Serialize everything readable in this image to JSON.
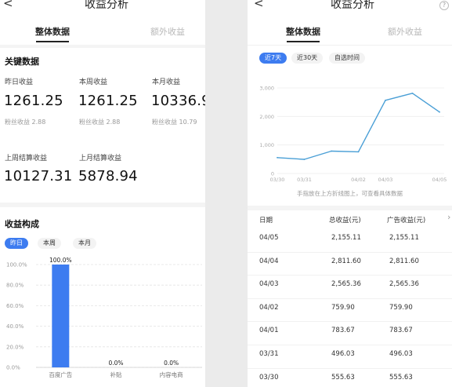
{
  "left": {
    "title": "收益分析",
    "back_glyph": "<",
    "tabs": [
      {
        "label": "整体数据",
        "active": true
      },
      {
        "label": "额外收益",
        "active": false
      }
    ],
    "key_title": "关键数据",
    "metrics": [
      {
        "label": "昨日收益",
        "value": "1261.25",
        "sub": "粉丝收益 2.88"
      },
      {
        "label": "本周收益",
        "value": "1261.25",
        "sub": "粉丝收益 2.88"
      },
      {
        "label": "本月收益",
        "value": "10336.9",
        "sub": "粉丝收益 10.79"
      },
      {
        "label": "上周结算收益",
        "value": "10127.31",
        "sub": ""
      },
      {
        "label": "上月结算收益",
        "value": "5878.94",
        "sub": ""
      }
    ],
    "composition_title": "收益构成",
    "period_pills": [
      {
        "label": "昨日",
        "selected": true
      },
      {
        "label": "本周",
        "selected": false
      },
      {
        "label": "本月",
        "selected": false
      }
    ]
  },
  "right": {
    "title": "收益分析",
    "back_glyph": "<",
    "help_glyph": "?",
    "tabs": [
      {
        "label": "整体数据",
        "active": true
      },
      {
        "label": "额外收益",
        "active": false
      }
    ],
    "range_pills": [
      {
        "label": "近7天",
        "selected": true
      },
      {
        "label": "近30天",
        "selected": false
      },
      {
        "label": "自选时间",
        "selected": false
      }
    ],
    "chart_hint": "手指放在上方折线图上，可查看具体数据",
    "table": {
      "headers": [
        "日期",
        "总收益(元)",
        "广告收益(元)"
      ],
      "more_glyph": "›",
      "rows": [
        [
          "04/05",
          "2,155.11",
          "2,155.11"
        ],
        [
          "04/04",
          "2,811.60",
          "2,811.60"
        ],
        [
          "04/03",
          "2,565.36",
          "2,565.36"
        ],
        [
          "04/02",
          "759.90",
          "759.90"
        ],
        [
          "04/01",
          "783.67",
          "783.67"
        ],
        [
          "03/31",
          "496.03",
          "496.03"
        ],
        [
          "03/30",
          "555.63",
          "555.63"
        ]
      ]
    }
  },
  "colors": {
    "accent": "#3d7cf0",
    "line": "#4a9fd6"
  },
  "chart_data": [
    {
      "type": "bar",
      "categories": [
        "百度广告",
        "补贴",
        "内容电商"
      ],
      "values": [
        100.0,
        0.0,
        0.0
      ],
      "data_labels": [
        "100.0%",
        "0.0%",
        "0.0%"
      ],
      "ylim": [
        0,
        100
      ],
      "yticks": [
        0,
        20,
        40,
        60,
        80,
        100
      ],
      "ytick_labels": [
        "0.0%",
        "20.0%",
        "40.0%",
        "60.0%",
        "80.0%",
        "100.0%"
      ],
      "grid": true
    },
    {
      "type": "line",
      "x": [
        "03/30",
        "03/31",
        "04/01",
        "04/02",
        "04/03",
        "04/04",
        "04/05"
      ],
      "values": [
        555.63,
        496.03,
        783.67,
        759.9,
        2565.36,
        2811.6,
        2155.11
      ],
      "xtick_labels": [
        "03/30",
        "03/31",
        "04/02",
        "04/03",
        "04/05"
      ],
      "xtick_index": [
        0,
        1,
        3,
        4,
        6
      ],
      "ylim": [
        0,
        3000
      ],
      "yticks": [
        0,
        1000,
        2000,
        3000
      ],
      "ytick_labels": [
        "0",
        "1,000",
        "2,000",
        "3,000"
      ],
      "grid": true
    }
  ]
}
